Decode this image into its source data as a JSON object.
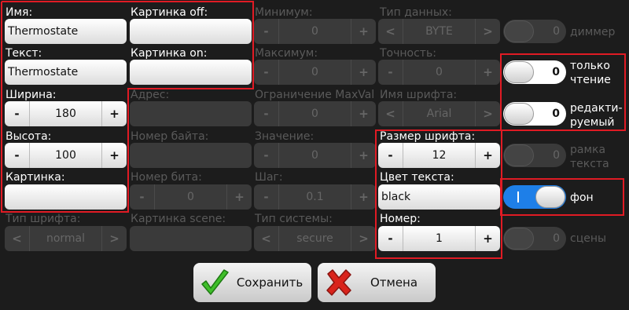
{
  "col1": {
    "name_label": "Имя:",
    "name_value": "Thermostate",
    "text_label": "Текст:",
    "text_value": "Thermostate",
    "width_label": "Ширина:",
    "width_value": "180",
    "height_label": "Высота:",
    "height_value": "100",
    "picture_label": "Картинка:",
    "font_type_label": "Тип шрифта:",
    "font_type_value": "normal"
  },
  "col2": {
    "pic_off_label": "Картинка off:",
    "pic_on_label": "Картинка on:",
    "address_label": "Адрес:",
    "byte_label": "Номер байта:",
    "bit_label": "Номер бита:",
    "bit_value": "0",
    "scene_pic_label": "Картинка scene:"
  },
  "col3": {
    "min_label": "Минимум:",
    "min_value": "0",
    "max_label": "Максимум:",
    "max_value": "0",
    "maxval_label": "Ограничение MaxVal",
    "maxval_value": "0",
    "value_label": "Значение:",
    "value_value": "0",
    "step_label": "Шаг:",
    "step_value": "0.1",
    "system_label": "Тип системы:",
    "system_value": "secure"
  },
  "col4": {
    "datatype_label": "Тип данных:",
    "datatype_value": "BYTE",
    "precision_label": "Точность:",
    "precision_value": "0",
    "fontname_label": "Имя шрифта:",
    "fontname_value": "Arial",
    "fontsize_label": "Размер шрифта:",
    "fontsize_value": "12",
    "textcolor_label": "Цвет текста:",
    "textcolor_value": "black",
    "number_label": "Номер:",
    "number_value": "1"
  },
  "col5": {
    "dimmer_toggle_value": "0",
    "dimmer_label": "диммер",
    "readonly_toggle_value": "0",
    "readonly_label_1": "только",
    "readonly_label_2": "чтение",
    "editable_toggle_value": "0",
    "editable_label_1": "редакти-",
    "editable_label_2": "руемый",
    "frame_toggle_value": "0",
    "frame_label_1": "рамка",
    "frame_label_2": "текста",
    "bg_label": "фон",
    "scenes_toggle_value": "0",
    "scenes_label": "сцены"
  },
  "buttons": {
    "minus": "-",
    "plus": "+",
    "left_arrow": "<",
    "right_arrow": ">",
    "save": "Сохранить",
    "cancel": "Отмена"
  },
  "icons": {
    "save": "checkmark-icon",
    "cancel": "x-icon"
  },
  "colors": {
    "background": "#1c1c1c",
    "highlight_border": "#e01b24",
    "toggle_on": "#1e7fe8",
    "save_icon": "#3fbf2a",
    "cancel_icon": "#d9231b"
  }
}
